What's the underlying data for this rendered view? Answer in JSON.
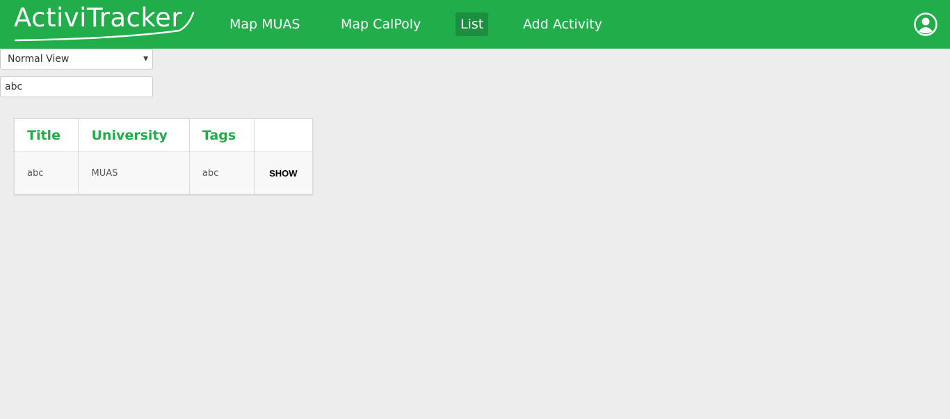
{
  "app": {
    "logo_text": "ActiviTracker"
  },
  "nav": {
    "items": [
      {
        "label": "Map MUAS"
      },
      {
        "label": "Map CalPoly"
      },
      {
        "label": "List"
      },
      {
        "label": "Add Activity"
      }
    ],
    "active": "List"
  },
  "profile_icon": "user-circle-icon",
  "view_select": {
    "value": "Normal View"
  },
  "search": {
    "value": "abc"
  },
  "table": {
    "headers": [
      "Title",
      "University",
      "Tags",
      ""
    ],
    "rows": [
      {
        "title": "abc",
        "university": "MUAS",
        "tags": "abc",
        "action": "SHOW"
      }
    ]
  },
  "colors": {
    "brand": "#22ad4b",
    "nav_active": "#1c8f3e",
    "background": "#ededed"
  }
}
